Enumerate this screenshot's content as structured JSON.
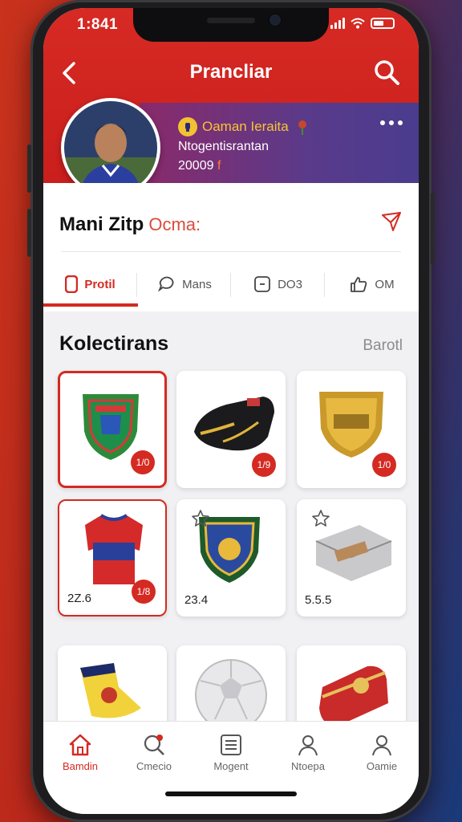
{
  "status": {
    "time": "1:841"
  },
  "header": {
    "title": "Prancliar",
    "back_icon": "chevron-left-icon",
    "search_icon": "search-icon"
  },
  "profile": {
    "badge": "Oaman Ieraita",
    "line1": "Ntogentisrantan",
    "line2_num": "20009",
    "line2_mark": "f",
    "name": "Mani Zitp",
    "name_secondary": "Ocma:"
  },
  "tabs": [
    {
      "label": "Protil",
      "icon": "badge-icon",
      "active": true
    },
    {
      "label": "Mans",
      "icon": "chat-icon",
      "active": false
    },
    {
      "label": "DO3",
      "icon": "square-icon",
      "active": false
    },
    {
      "label": "OM",
      "icon": "thumbs-up-icon",
      "active": false
    }
  ],
  "section": {
    "title": "Kolectirans",
    "link": "Barotl"
  },
  "items": [
    {
      "kind": "crest-green",
      "price": "1/0"
    },
    {
      "kind": "gloves",
      "price": "1/9"
    },
    {
      "kind": "gold-badge",
      "price": "1/0"
    },
    {
      "kind": "jersey",
      "label": "2Z.6",
      "price": "1/8"
    },
    {
      "kind": "crest-blue",
      "label": "23.4"
    },
    {
      "kind": "cards",
      "label": "5.5.5"
    },
    {
      "kind": "scarf"
    },
    {
      "kind": "ball"
    },
    {
      "kind": "can"
    }
  ],
  "nav": [
    {
      "label": "Bamdin",
      "icon": "home-icon",
      "active": true
    },
    {
      "label": "Cmecio",
      "icon": "search-icon",
      "active": false
    },
    {
      "label": "Mogent",
      "icon": "list-icon",
      "active": false
    },
    {
      "label": "Ntoepa",
      "icon": "user-icon",
      "active": false
    },
    {
      "label": "Oamie",
      "icon": "profile-icon",
      "active": false
    }
  ],
  "colors": {
    "accent": "#d42a22",
    "banner": "#5a3a8a",
    "badge": "#f6c535"
  }
}
